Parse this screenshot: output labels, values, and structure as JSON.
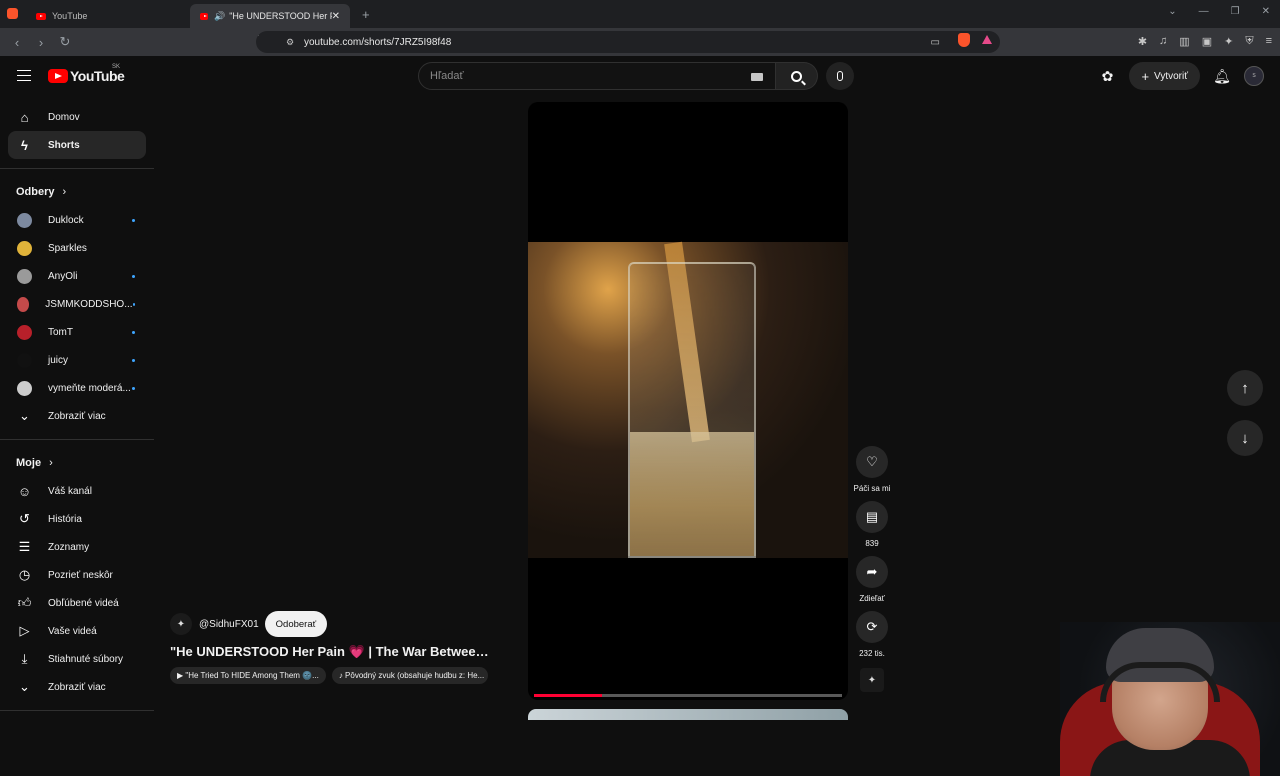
{
  "browser": {
    "tabs": [
      {
        "title": "YouTube"
      },
      {
        "title": "\"He UNDERSTOOD Her Pain ❤"
      }
    ],
    "url": "youtube.com/shorts/7JRZ5I98f48"
  },
  "topbar": {
    "logo_text": "YouTube",
    "country_code": "SK",
    "search_placeholder": "Hľadať",
    "create_label": "Vytvoriť"
  },
  "sidebar": {
    "main": [
      {
        "label": "Domov",
        "icon": "home-icon"
      },
      {
        "label": "Shorts",
        "icon": "shorts-icon",
        "active": true
      }
    ],
    "subscriptions_title": "Odbery",
    "subscriptions": [
      {
        "label": "Duklock",
        "color": "#7d8aa0",
        "new": true
      },
      {
        "label": "Sparkles",
        "color": "#e0b33a",
        "new": false
      },
      {
        "label": "AnyOli",
        "color": "#9a9a9a",
        "new": true
      },
      {
        "label": "JSMMKODDSHO...",
        "color": "#c44a4a",
        "new": true
      },
      {
        "label": "TomT",
        "color": "#b8202a",
        "new": true
      },
      {
        "label": "juicy",
        "color": "#111111",
        "new": true
      },
      {
        "label": "vymeňte moderá...",
        "color": "#cccccc",
        "new": true
      }
    ],
    "show_more_1": "Zobraziť viac",
    "you_title": "Moje",
    "you_items": [
      {
        "label": "Váš kanál",
        "icon": "channel-icon"
      },
      {
        "label": "História",
        "icon": "history-icon"
      },
      {
        "label": "Zoznamy",
        "icon": "playlists-icon"
      },
      {
        "label": "Pozrieť neskôr",
        "icon": "watch-later-icon"
      },
      {
        "label": "Obľúbené videá",
        "icon": "liked-icon"
      },
      {
        "label": "Vaše videá",
        "icon": "your-videos-icon"
      },
      {
        "label": "Stiahnuté súbory",
        "icon": "downloads-icon"
      }
    ],
    "show_more_2": "Zobraziť viac"
  },
  "short": {
    "channel": "@SidhuFX01",
    "subscribe_label": "Odoberať",
    "title": "\"He UNDERSTOOD Her Pain 💗 | The War Between ...",
    "chip_1": "▶ \"He Tried To HIDE Among Them 🌚...",
    "chip_2": "♪ Pôvodný zvuk (obsahuje hudbu z: He...",
    "progress": 0.22
  },
  "actions": {
    "like_label": "Páči sa mi",
    "comments_count": "839",
    "share_label": "Zdieľať",
    "remix_count": "232 tis."
  },
  "colors": {
    "accent": "#ff0033",
    "subscribe_bg": "#f1f1f1",
    "new_dot": "#3ea6ff"
  }
}
